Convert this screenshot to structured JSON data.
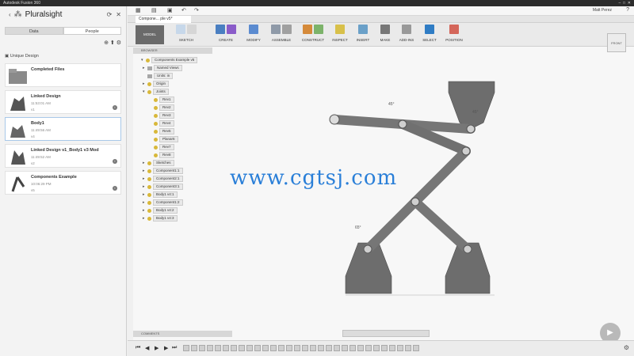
{
  "window": {
    "title": "Autodesk Fusion 360"
  },
  "left_panel": {
    "title": "Pluralsight",
    "tabs": [
      "Data",
      "People"
    ],
    "breadcrumb": "Unique Design",
    "items": [
      {
        "name": "Completed Files",
        "time": "",
        "version": ""
      },
      {
        "name": "Linked Design",
        "time": "11:53:01 AM",
        "version": "v1"
      },
      {
        "name": "Body1",
        "time": "11:49:56 AM",
        "version": "v4"
      },
      {
        "name": "Linked Design v1_Body1 v3 Mod",
        "time": "11:49:52 AM",
        "version": "v2"
      },
      {
        "name": "Components Example",
        "time": "10:06:29 PM",
        "version": "v5"
      }
    ]
  },
  "toolbar": {
    "user": "Matt Perez",
    "help_icon": "help-icon"
  },
  "doc_tab": {
    "label": "Compone... ple v5*"
  },
  "ribbon": {
    "model": "MODEL",
    "groups": [
      "SKETCH",
      "CREATE",
      "MODIFY",
      "ASSEMBLE",
      "CONSTRUCT",
      "INSPECT",
      "INSERT",
      "MAKE",
      "ADD-INS",
      "SELECT",
      "POSITION"
    ]
  },
  "browser": {
    "header": "BROWSER",
    "root": "Components Example v5",
    "rows": [
      "Named Views",
      "Units: in",
      "Origin",
      "Joints",
      "Rev1",
      "Rev2",
      "Rev3",
      "Rev4",
      "Rev5",
      "Planar6",
      "Rev7",
      "Rev8",
      "Sketches",
      "Component1:1",
      "Component2:1",
      "Component3:1",
      "Body1 v4:1",
      "Component1:2",
      "Body1 v4:2",
      "Body1 v4:3"
    ]
  },
  "watermark": "www.cgtsj.com",
  "viewcube": "FRONT",
  "comments": "COMMENTS",
  "dimensions": [
    "45°",
    "65°",
    "45°",
    "90°",
    "90°"
  ],
  "colors": {
    "accent": "#2a7fd8",
    "part": "#6d6d6d",
    "ground": "#e0e0e0"
  }
}
